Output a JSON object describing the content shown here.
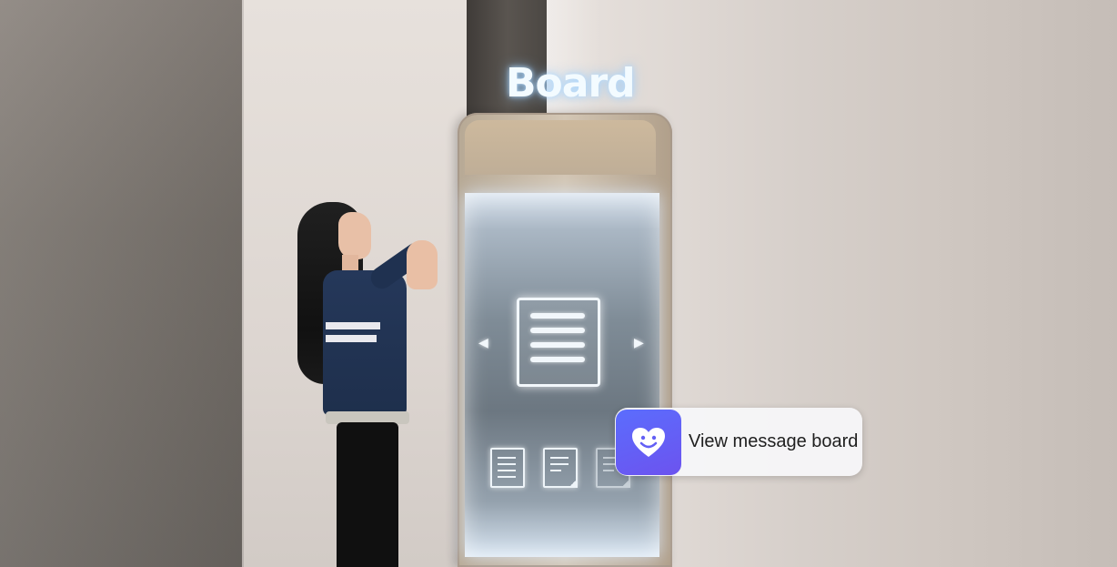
{
  "sign": {
    "title": "Board"
  },
  "prompt": {
    "label": "View message board"
  },
  "colors": {
    "prompt_icon": "#6360f5",
    "sign_glow": "#bfe2ff"
  }
}
